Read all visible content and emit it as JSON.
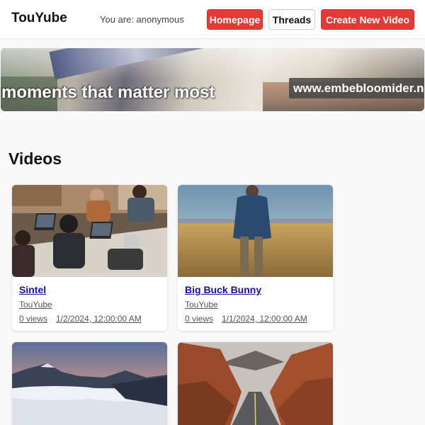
{
  "header": {
    "logo": "TouYube",
    "user_status": "You are: anonymous",
    "nav": {
      "homepage": "Homepage",
      "threads": "Threads",
      "create": "Create New Video"
    }
  },
  "banner": {
    "tagline": "moments that matter most",
    "url": "www.embebloomider.n"
  },
  "section_title": "Videos",
  "videos": [
    {
      "title": "Sintel",
      "channel": "TouYube",
      "views": "0 views",
      "date": "1/2/2024, 12:00:00 AM"
    },
    {
      "title": "Big Buck Bunny",
      "channel": "TouYube",
      "views": "0 views",
      "date": "1/1/2024, 12:00:00 AM"
    },
    {
      "title": "",
      "channel": "",
      "views": "",
      "date": ""
    },
    {
      "title": "",
      "channel": "",
      "views": "",
      "date": ""
    }
  ],
  "colors": {
    "accent": "#e53935",
    "link": "#1a0dab"
  }
}
